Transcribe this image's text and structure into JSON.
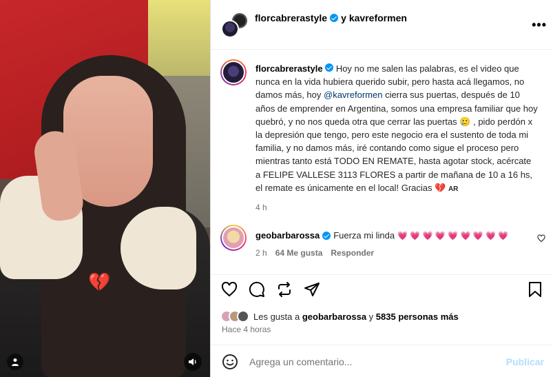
{
  "header": {
    "author": "florcabrerastyle",
    "conjunction": "y",
    "collaborator": "kavreformen",
    "more_icon": "more-icon"
  },
  "caption": {
    "user": "florcabrerastyle",
    "text_1": "Hoy no me salen las palabras, es el video que nunca en la vida hubiera querido subir, pero hasta acá llegamos, no damos más, hoy ",
    "mention": "@kavreformen",
    "text_2": " cierra sus puertas, después de 10 años de emprender en Argentina, somos una empresa familiar que hoy quebró, y no nos queda otra que cerrar las puertas ",
    "emoji_1": "🥲",
    "text_3": " , pido perdón x la depresión que tengo, pero este negocio era el sustento de toda mi familia, y no damos más, iré contando como sigue el proceso pero mientras tanto está TODO EN REMATE, hasta agotar stock, acércate a FELIPE VALLESE 3113 FLORES a partir de mañana de 10 a 16 hs, el remate es únicamente en el local! Gracias ",
    "emoji_2": "💔",
    "flag": "AR",
    "time": "4 h"
  },
  "comment": {
    "user": "geobarbarossa",
    "text": "Fuerza mi linda",
    "hearts": "💗 💗 💗 💗 💗 💗 💗 💗 💗",
    "time": "2 h",
    "likes": "64 Me gusta",
    "reply": "Responder"
  },
  "likes": {
    "prefix": "Les gusta a",
    "user": "geobarbarossa",
    "middle": "y",
    "count": "5835 personas más"
  },
  "posted": "Hace 4 horas",
  "add_comment": {
    "placeholder": "Agrega un comentario...",
    "publish": "Publicar"
  },
  "media": {
    "sticker": "💔"
  },
  "colors": {
    "verified": "#0095f6",
    "mention": "#00376b",
    "publish_disabled": "#b2dffc",
    "muted": "#737373"
  }
}
